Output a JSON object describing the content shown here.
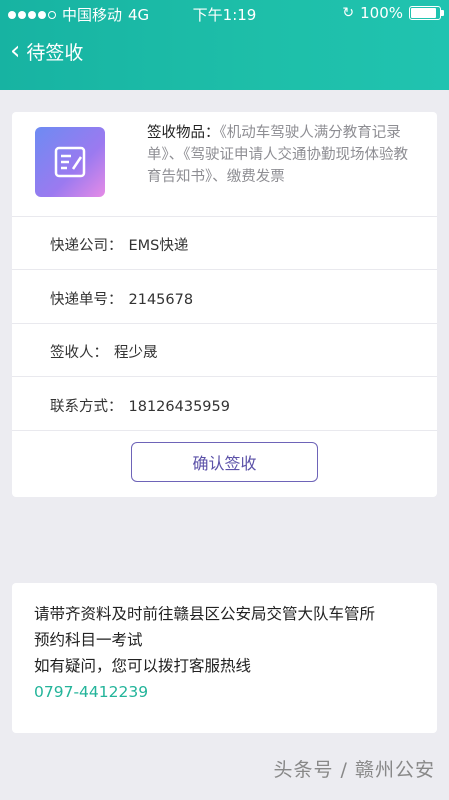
{
  "status_bar": {
    "carrier": "中国移动",
    "network": "4G",
    "time": "下午1:19",
    "battery": "100%",
    "battery_level": 1.0,
    "signal_bars": 4,
    "signal_total": 5
  },
  "header": {
    "title": "待签收",
    "back_icon": "chevron-left-icon",
    "color": "#1ebfa9"
  },
  "delivery": {
    "item_label": "签收物品：",
    "item_value": "《机动车驾驶人满分教育记录单》、《驾驶证申请人交通协勤现场体验教育告知书》、缴费发票",
    "courier_label": "快递公司：",
    "courier_value": "EMS快递",
    "tracking_label": "快递单号：",
    "tracking_value": "2145678",
    "recipient_label": "签收人：",
    "recipient_value": "程少晟",
    "contact_label": "联系方式：",
    "contact_value": "18126435959",
    "confirm_button": "确认签收"
  },
  "notice": {
    "line1": "请带齐资料及时前往赣县区公安局交管大队车管所",
    "line2": "预约科目一考试",
    "line3": "如有疑问，您可以拨打客服热线",
    "phone": "0797-4412239",
    "phone_color": "#23b49a"
  },
  "watermark": "头条号 / 赣州公安"
}
